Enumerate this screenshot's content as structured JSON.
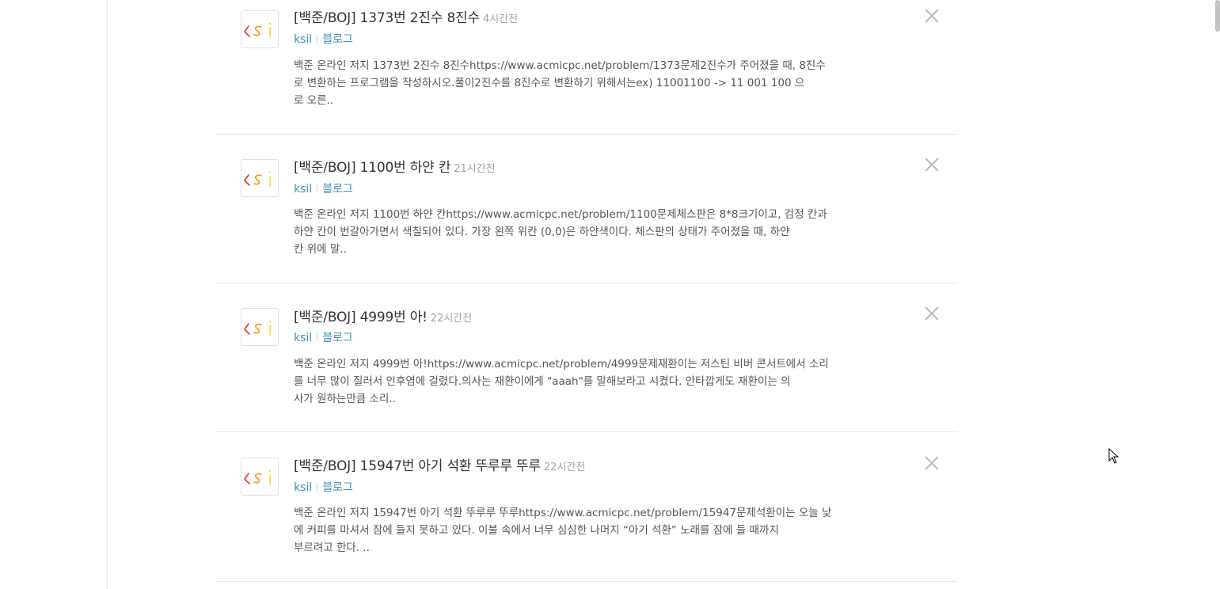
{
  "feed": {
    "posts": [
      {
        "title": "[백준/BOJ] 1373번 2진수 8진수",
        "time": "4시간전",
        "author": "ksil",
        "category": "블로그",
        "excerpt_lines": [
          "백준 온라인 저지 1373번 2진수 8진수https://www.acmicpc.net/problem/1373문제2진수가 주어졌을 때, 8진수",
          "로 변환하는 프로그램을 작성하시오.풀이2진수를 8진수로 변환하기 위해서는ex) 11001100 -> 11 001 100 으",
          "로 오른.."
        ]
      },
      {
        "title": "[백준/BOJ] 1100번 하얀 칸",
        "time": "21시간전",
        "author": "ksil",
        "category": "블로그",
        "excerpt_lines": [
          "백준 온라인 저지 1100번 하얀 칸https://www.acmicpc.net/problem/1100문제체스판은 8*8크기이고, 검정 칸과",
          "하얀 칸이 번갈아가면서 색칠되어 있다. 가장 왼쪽 위칸 (0,0)은 하얀색이다. 체스판의 상태가 주어졌을 때, 하얀",
          "칸 위에 말.."
        ]
      },
      {
        "title": "[백준/BOJ] 4999번 아!",
        "time": "22시간전",
        "author": "ksil",
        "category": "블로그",
        "excerpt_lines": [
          "백준 온라인 저지 4999번 아!https://www.acmicpc.net/problem/4999문제재환이는 저스틴 비버 콘서트에서 소리",
          "를 너무 많이 질러서 인후염에 걸렸다.의사는 재환이에게 \"aaah\"를 말해보라고 시켰다. 안타깝게도 재환이는 의",
          "사가 원하는만큼 소리.."
        ]
      },
      {
        "title": "[백준/BOJ] 15947번 아기 석환 뚜루루 뚜루",
        "time": "22시간전",
        "author": "ksil",
        "category": "블로그",
        "excerpt_lines": [
          "백준 온라인 저지 15947번 아기 석환 뚜루루 뚜루https://www.acmicpc.net/problem/15947문제석환이는 오늘 낮",
          "에 커피를 마셔서 잠에 들지 못하고 있다. 이불 속에서 너무 심심한 나머지 “아기 석환” 노래를 잠에 들 때까지",
          "부르려고 한다. .."
        ]
      }
    ]
  },
  "avatar_colors": {
    "k": "#e53935",
    "s": "#ff8f00",
    "i": "#fdd835"
  },
  "icons": {
    "close": "close-icon",
    "avatar": "ksi-logo-icon",
    "cursor": "mouse-pointer-icon"
  }
}
